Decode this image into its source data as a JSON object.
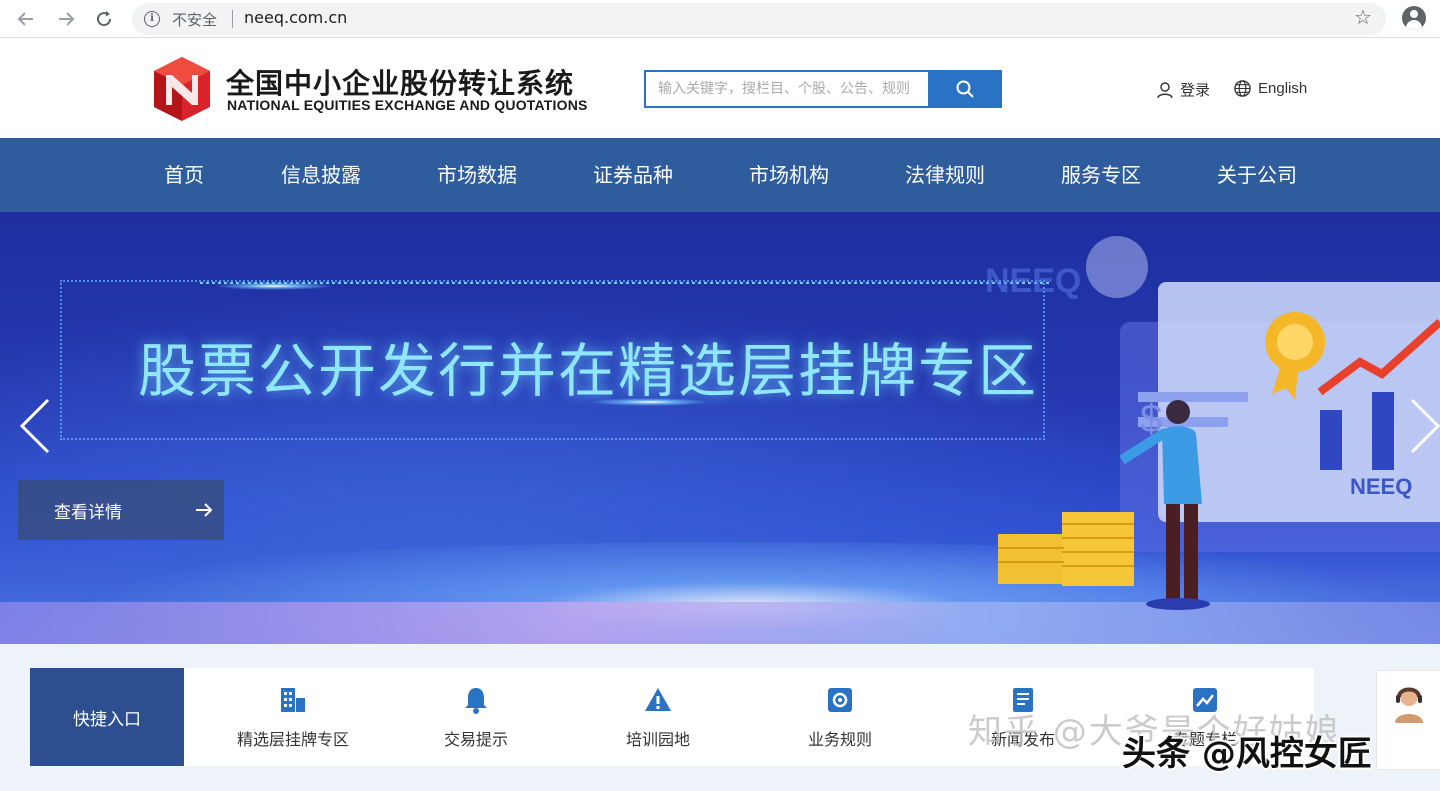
{
  "browser": {
    "security_label": "不安全",
    "url": "neeq.com.cn"
  },
  "header": {
    "logo_cn": "全国中小企业股份转让系统",
    "logo_en": "NATIONAL EQUITIES EXCHANGE AND QUOTATIONS",
    "search_placeholder": "输入关键字，搜栏目、个股、公告、规则",
    "login_label": "登录",
    "language_label": "English"
  },
  "nav": {
    "items": [
      "首页",
      "信息披露",
      "市场数据",
      "证券品种",
      "市场机构",
      "法律规则",
      "服务专区",
      "关于公司"
    ]
  },
  "banner": {
    "title": "股票公开发行并在精选层挂牌专区",
    "detail_label": "查看详情",
    "watermark": "NEEQ"
  },
  "quick": {
    "title": "快捷入口",
    "items": [
      {
        "label": "精选层挂牌专区",
        "icon": "building-icon"
      },
      {
        "label": "交易提示",
        "icon": "bell-icon"
      },
      {
        "label": "培训园地",
        "icon": "warning-icon"
      },
      {
        "label": "业务规则",
        "icon": "gear-doc-icon"
      },
      {
        "label": "新闻发布",
        "icon": "document-icon"
      },
      {
        "label": "专题专栏",
        "icon": "trend-chart-icon"
      }
    ]
  },
  "overlay": {
    "zhihu": "知乎 @大爷是个好姑娘",
    "toutiao": "头条 @风控女匠"
  },
  "colors": {
    "nav_bg": "#2e5c9c",
    "accent_blue": "#2a72c4",
    "quick_title_bg": "#2e4f8f"
  }
}
